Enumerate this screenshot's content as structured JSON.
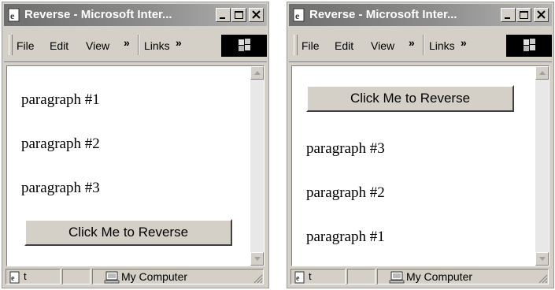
{
  "windows": [
    {
      "title": "Reverse - Microsoft Inter...",
      "menu": {
        "file": "File",
        "edit": "Edit",
        "view": "View",
        "chevron": "»",
        "links": "Links",
        "links_chevron": "»"
      },
      "content": {
        "paragraphs": [
          "paragraph #1",
          "paragraph #2",
          "paragraph #3"
        ],
        "button_label": "Click Me to Reverse",
        "button_position": "bottom"
      },
      "status": {
        "text": "t",
        "zone": "My Computer"
      }
    },
    {
      "title": "Reverse - Microsoft Inter...",
      "menu": {
        "file": "File",
        "edit": "Edit",
        "view": "View",
        "chevron": "»",
        "links": "Links",
        "links_chevron": "»"
      },
      "content": {
        "paragraphs": [
          "paragraph #3",
          "paragraph #2",
          "paragraph #1"
        ],
        "button_label": "Click Me to Reverse",
        "button_position": "top"
      },
      "status": {
        "text": "t",
        "zone": "My Computer"
      }
    }
  ],
  "icons": {
    "app": "ie-page-icon",
    "minimize": "minimize-icon",
    "maximize": "maximize-icon",
    "close": "close-icon",
    "logo": "windows-logo-icon",
    "status_page": "page-status-icon",
    "zone": "my-computer-icon"
  },
  "colors": {
    "titlebar": "#7d7d7d",
    "chrome": "#d4d0c8",
    "content": "#ffffff"
  }
}
